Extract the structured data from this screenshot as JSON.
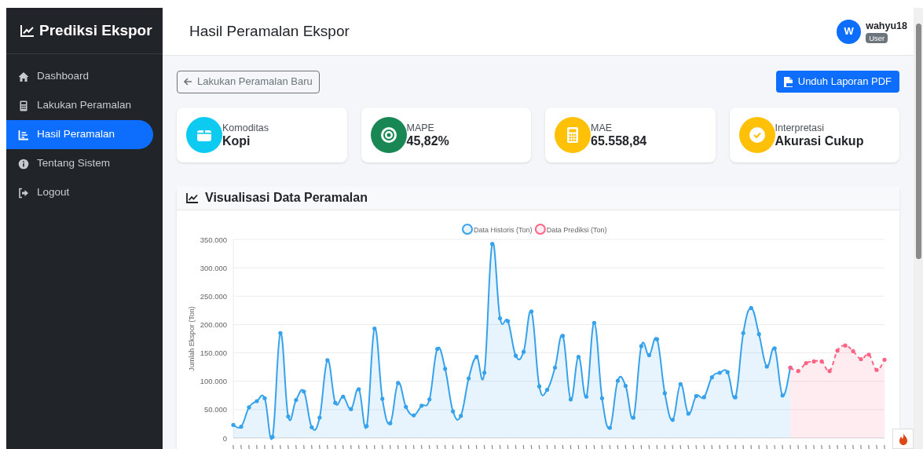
{
  "sidebar": {
    "brand": "Prediksi Ekspor",
    "items": [
      {
        "label": "Dashboard",
        "selected": false
      },
      {
        "label": "Lakukan Peramalan",
        "selected": false
      },
      {
        "label": "Hasil Peramalan",
        "selected": true
      },
      {
        "label": "Tentang Sistem",
        "selected": false
      },
      {
        "label": "Logout",
        "selected": false
      }
    ]
  },
  "header": {
    "title": "Hasil Peramalan Ekspor",
    "user": {
      "initial": "W",
      "name": "wahyu18",
      "role": "User"
    }
  },
  "actions": {
    "back_button": "Lakukan Peramalan Baru",
    "pdf_button": "Unduh Laporan PDF"
  },
  "stats": [
    {
      "label": "Komoditas",
      "value": "Kopi",
      "color": "#0dcaf0"
    },
    {
      "label": "MAPE",
      "value": "45,82%",
      "color": "#198754"
    },
    {
      "label": "MAE",
      "value": "65.558,84",
      "color": "#ffc107"
    },
    {
      "label": "Interpretasi",
      "value": "Akurasi Cukup",
      "color": "#ffc107"
    }
  ],
  "chart_card": {
    "title": "Visualisasi Data Peramalan",
    "chart_data": {
      "type": "area",
      "ylabel": "Jumlah Ekspor (Ton)",
      "ylim": [
        0,
        350000
      ],
      "grid": true,
      "legend": true,
      "yticks": [
        {
          "value": 0,
          "label": "0"
        },
        {
          "value": 50000,
          "label": "50.000"
        },
        {
          "value": 100000,
          "label": "100.000"
        },
        {
          "value": 150000,
          "label": "150.000"
        },
        {
          "value": 200000,
          "label": "200.000"
        },
        {
          "value": 250000,
          "label": "250.000"
        },
        {
          "value": 300000,
          "label": "300.000"
        },
        {
          "value": 350000,
          "label": "350.000"
        }
      ],
      "series": [
        {
          "name": "Data Historis (Ton)",
          "color": "#36a2eb",
          "line_style": "solid",
          "values": [
            23000,
            20000,
            54000,
            65000,
            70000,
            2000,
            185000,
            38000,
            67000,
            82000,
            19000,
            36000,
            137000,
            62000,
            73000,
            51000,
            86000,
            21000,
            193000,
            69000,
            26000,
            97000,
            55000,
            40000,
            57000,
            68000,
            157000,
            122000,
            47000,
            39000,
            105000,
            143000,
            115000,
            342000,
            211000,
            206000,
            145000,
            152000,
            223000,
            91000,
            85000,
            124000,
            180000,
            68000,
            143000,
            73000,
            203000,
            70000,
            18000,
            101000,
            92000,
            36000,
            162000,
            146000,
            174000,
            79000,
            32000,
            95000,
            43000,
            74000,
            72000,
            107000,
            115000,
            116000,
            72000,
            185000,
            229000,
            183000,
            126000,
            158000,
            75000,
            124000,
            null,
            null,
            null,
            null,
            null,
            null,
            null,
            null,
            null,
            null,
            null,
            null
          ]
        },
        {
          "name": "Data Prediksi (Ton)",
          "color": "#ff6384",
          "line_style": "dashed",
          "values": [
            null,
            null,
            null,
            null,
            null,
            null,
            null,
            null,
            null,
            null,
            null,
            null,
            null,
            null,
            null,
            null,
            null,
            null,
            null,
            null,
            null,
            null,
            null,
            null,
            null,
            null,
            null,
            null,
            null,
            null,
            null,
            null,
            null,
            null,
            null,
            null,
            null,
            null,
            null,
            null,
            null,
            null,
            null,
            null,
            null,
            null,
            null,
            null,
            null,
            null,
            null,
            null,
            null,
            null,
            null,
            null,
            null,
            null,
            null,
            null,
            null,
            null,
            null,
            null,
            null,
            null,
            null,
            null,
            null,
            null,
            null,
            124000,
            118000,
            132000,
            135000,
            135000,
            118000,
            154000,
            163000,
            153000,
            139000,
            147000,
            120000,
            138000
          ]
        }
      ]
    }
  }
}
